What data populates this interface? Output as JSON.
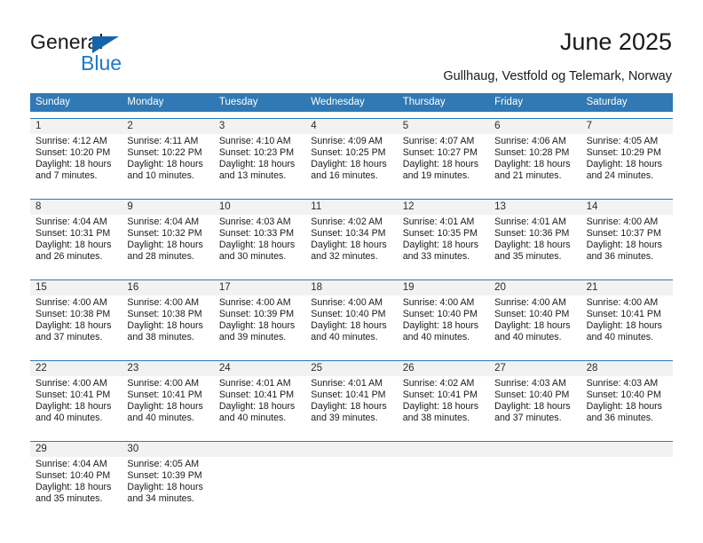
{
  "logo": {
    "word1": "General",
    "word2": "Blue",
    "triangle_color": "#1464aa",
    "blue_color": "#1e78c8"
  },
  "header": {
    "title": "June 2025",
    "subtitle": "Gullhaug, Vestfold og Telemark, Norway"
  },
  "theme": {
    "header_band": "#3079b4",
    "daynum_strip": "#f2f2f2",
    "text": "#1a1a1a"
  },
  "weekdays": [
    "Sunday",
    "Monday",
    "Tuesday",
    "Wednesday",
    "Thursday",
    "Friday",
    "Saturday"
  ],
  "weeks": [
    [
      {
        "day": "1",
        "sunrise": "Sunrise: 4:12 AM",
        "sunset": "Sunset: 10:20 PM",
        "daylight1": "Daylight: 18 hours",
        "daylight2": "and 7 minutes."
      },
      {
        "day": "2",
        "sunrise": "Sunrise: 4:11 AM",
        "sunset": "Sunset: 10:22 PM",
        "daylight1": "Daylight: 18 hours",
        "daylight2": "and 10 minutes."
      },
      {
        "day": "3",
        "sunrise": "Sunrise: 4:10 AM",
        "sunset": "Sunset: 10:23 PM",
        "daylight1": "Daylight: 18 hours",
        "daylight2": "and 13 minutes."
      },
      {
        "day": "4",
        "sunrise": "Sunrise: 4:09 AM",
        "sunset": "Sunset: 10:25 PM",
        "daylight1": "Daylight: 18 hours",
        "daylight2": "and 16 minutes."
      },
      {
        "day": "5",
        "sunrise": "Sunrise: 4:07 AM",
        "sunset": "Sunset: 10:27 PM",
        "daylight1": "Daylight: 18 hours",
        "daylight2": "and 19 minutes."
      },
      {
        "day": "6",
        "sunrise": "Sunrise: 4:06 AM",
        "sunset": "Sunset: 10:28 PM",
        "daylight1": "Daylight: 18 hours",
        "daylight2": "and 21 minutes."
      },
      {
        "day": "7",
        "sunrise": "Sunrise: 4:05 AM",
        "sunset": "Sunset: 10:29 PM",
        "daylight1": "Daylight: 18 hours",
        "daylight2": "and 24 minutes."
      }
    ],
    [
      {
        "day": "8",
        "sunrise": "Sunrise: 4:04 AM",
        "sunset": "Sunset: 10:31 PM",
        "daylight1": "Daylight: 18 hours",
        "daylight2": "and 26 minutes."
      },
      {
        "day": "9",
        "sunrise": "Sunrise: 4:04 AM",
        "sunset": "Sunset: 10:32 PM",
        "daylight1": "Daylight: 18 hours",
        "daylight2": "and 28 minutes."
      },
      {
        "day": "10",
        "sunrise": "Sunrise: 4:03 AM",
        "sunset": "Sunset: 10:33 PM",
        "daylight1": "Daylight: 18 hours",
        "daylight2": "and 30 minutes."
      },
      {
        "day": "11",
        "sunrise": "Sunrise: 4:02 AM",
        "sunset": "Sunset: 10:34 PM",
        "daylight1": "Daylight: 18 hours",
        "daylight2": "and 32 minutes."
      },
      {
        "day": "12",
        "sunrise": "Sunrise: 4:01 AM",
        "sunset": "Sunset: 10:35 PM",
        "daylight1": "Daylight: 18 hours",
        "daylight2": "and 33 minutes."
      },
      {
        "day": "13",
        "sunrise": "Sunrise: 4:01 AM",
        "sunset": "Sunset: 10:36 PM",
        "daylight1": "Daylight: 18 hours",
        "daylight2": "and 35 minutes."
      },
      {
        "day": "14",
        "sunrise": "Sunrise: 4:00 AM",
        "sunset": "Sunset: 10:37 PM",
        "daylight1": "Daylight: 18 hours",
        "daylight2": "and 36 minutes."
      }
    ],
    [
      {
        "day": "15",
        "sunrise": "Sunrise: 4:00 AM",
        "sunset": "Sunset: 10:38 PM",
        "daylight1": "Daylight: 18 hours",
        "daylight2": "and 37 minutes."
      },
      {
        "day": "16",
        "sunrise": "Sunrise: 4:00 AM",
        "sunset": "Sunset: 10:38 PM",
        "daylight1": "Daylight: 18 hours",
        "daylight2": "and 38 minutes."
      },
      {
        "day": "17",
        "sunrise": "Sunrise: 4:00 AM",
        "sunset": "Sunset: 10:39 PM",
        "daylight1": "Daylight: 18 hours",
        "daylight2": "and 39 minutes."
      },
      {
        "day": "18",
        "sunrise": "Sunrise: 4:00 AM",
        "sunset": "Sunset: 10:40 PM",
        "daylight1": "Daylight: 18 hours",
        "daylight2": "and 40 minutes."
      },
      {
        "day": "19",
        "sunrise": "Sunrise: 4:00 AM",
        "sunset": "Sunset: 10:40 PM",
        "daylight1": "Daylight: 18 hours",
        "daylight2": "and 40 minutes."
      },
      {
        "day": "20",
        "sunrise": "Sunrise: 4:00 AM",
        "sunset": "Sunset: 10:40 PM",
        "daylight1": "Daylight: 18 hours",
        "daylight2": "and 40 minutes."
      },
      {
        "day": "21",
        "sunrise": "Sunrise: 4:00 AM",
        "sunset": "Sunset: 10:41 PM",
        "daylight1": "Daylight: 18 hours",
        "daylight2": "and 40 minutes."
      }
    ],
    [
      {
        "day": "22",
        "sunrise": "Sunrise: 4:00 AM",
        "sunset": "Sunset: 10:41 PM",
        "daylight1": "Daylight: 18 hours",
        "daylight2": "and 40 minutes."
      },
      {
        "day": "23",
        "sunrise": "Sunrise: 4:00 AM",
        "sunset": "Sunset: 10:41 PM",
        "daylight1": "Daylight: 18 hours",
        "daylight2": "and 40 minutes."
      },
      {
        "day": "24",
        "sunrise": "Sunrise: 4:01 AM",
        "sunset": "Sunset: 10:41 PM",
        "daylight1": "Daylight: 18 hours",
        "daylight2": "and 40 minutes."
      },
      {
        "day": "25",
        "sunrise": "Sunrise: 4:01 AM",
        "sunset": "Sunset: 10:41 PM",
        "daylight1": "Daylight: 18 hours",
        "daylight2": "and 39 minutes."
      },
      {
        "day": "26",
        "sunrise": "Sunrise: 4:02 AM",
        "sunset": "Sunset: 10:41 PM",
        "daylight1": "Daylight: 18 hours",
        "daylight2": "and 38 minutes."
      },
      {
        "day": "27",
        "sunrise": "Sunrise: 4:03 AM",
        "sunset": "Sunset: 10:40 PM",
        "daylight1": "Daylight: 18 hours",
        "daylight2": "and 37 minutes."
      },
      {
        "day": "28",
        "sunrise": "Sunrise: 4:03 AM",
        "sunset": "Sunset: 10:40 PM",
        "daylight1": "Daylight: 18 hours",
        "daylight2": "and 36 minutes."
      }
    ],
    [
      {
        "day": "29",
        "sunrise": "Sunrise: 4:04 AM",
        "sunset": "Sunset: 10:40 PM",
        "daylight1": "Daylight: 18 hours",
        "daylight2": "and 35 minutes."
      },
      {
        "day": "30",
        "sunrise": "Sunrise: 4:05 AM",
        "sunset": "Sunset: 10:39 PM",
        "daylight1": "Daylight: 18 hours",
        "daylight2": "and 34 minutes."
      },
      {
        "day": "",
        "sunrise": "",
        "sunset": "",
        "daylight1": "",
        "daylight2": ""
      },
      {
        "day": "",
        "sunrise": "",
        "sunset": "",
        "daylight1": "",
        "daylight2": ""
      },
      {
        "day": "",
        "sunrise": "",
        "sunset": "",
        "daylight1": "",
        "daylight2": ""
      },
      {
        "day": "",
        "sunrise": "",
        "sunset": "",
        "daylight1": "",
        "daylight2": ""
      },
      {
        "day": "",
        "sunrise": "",
        "sunset": "",
        "daylight1": "",
        "daylight2": ""
      }
    ]
  ]
}
